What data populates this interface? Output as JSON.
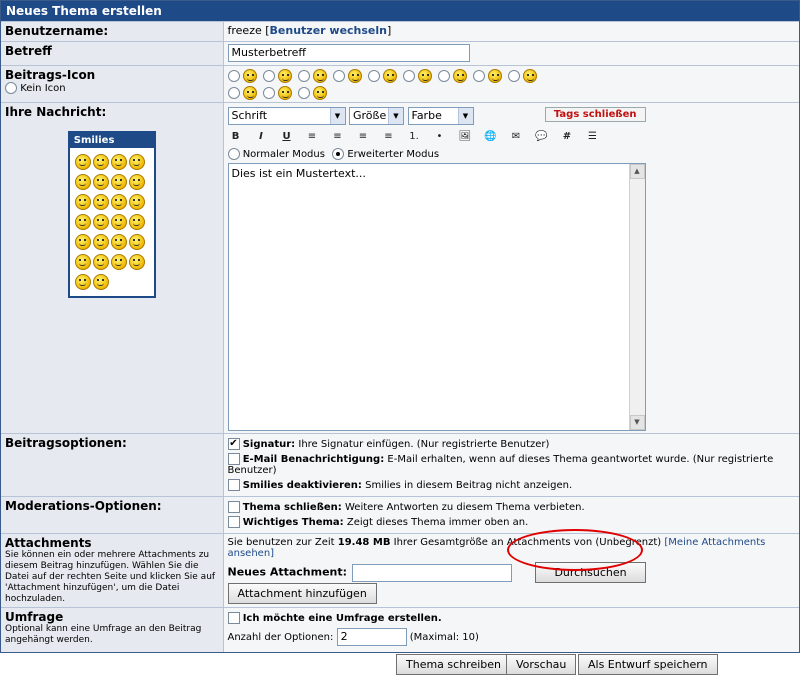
{
  "page_title": "Neues Thema erstellen",
  "username": {
    "label": "Benutzername:",
    "value": "freeze",
    "switch_link": "Benutzer wechseln"
  },
  "subject": {
    "label": "Betreff",
    "value": "Musterbetreff"
  },
  "post_icon": {
    "label": "Beitrags-Icon",
    "no_icon": "Kein Icon"
  },
  "message": {
    "label": "Ihre Nachricht:",
    "font_select": "Schrift",
    "size_select": "Größe",
    "color_select": "Farbe",
    "close_tags": "Tags schließen",
    "toolbar": [
      "B",
      "I",
      "U",
      "≡",
      "≡",
      "≡",
      "≡",
      "1.",
      "•",
      "🖼",
      "🌐",
      "✉",
      "💬",
      "#",
      "☰"
    ],
    "mode_normal": "Normaler Modus",
    "mode_extended": "Erweiterter Modus",
    "text": "Dies ist ein Mustertext..."
  },
  "smilies_header": "Smilies",
  "options": {
    "label": "Beitragsoptionen:",
    "signature_bold": "Signatur:",
    "signature_text": "Ihre Signatur einfügen. (Nur registrierte Benutzer)",
    "email_bold": "E-Mail Benachrichtigung:",
    "email_text": "E-Mail erhalten, wenn auf dieses Thema geantwortet wurde. (Nur registrierte Benutzer)",
    "smilies_bold": "Smilies deaktivieren:",
    "smilies_text": "Smilies in diesem Beitrag nicht anzeigen."
  },
  "moderation": {
    "label": "Moderations-Optionen:",
    "close_bold": "Thema schließen:",
    "close_text": "Weitere Antworten zu diesem Thema verbieten.",
    "sticky_bold": "Wichtiges Thema:",
    "sticky_text": "Zeigt dieses Thema immer oben an."
  },
  "attachments": {
    "label": "Attachments",
    "desc": "Sie können ein oder mehrere Attachments zu diesem Beitrag hinzufügen. Wählen Sie die Datei auf der rechten Seite und klicken Sie auf 'Attachment hinzufügen', um die Datei hochzuladen.",
    "usage_prefix": "Sie benutzen zur Zeit",
    "usage_size": "19.48 MB",
    "usage_suffix": "Ihrer Gesamtgröße an Attachments von (Unbegrenzt)",
    "my_attachments": "[Meine Attachments ansehen]",
    "new_label": "Neues Attachment:",
    "browse": "Durchsuchen",
    "add": "Attachment hinzufügen"
  },
  "poll": {
    "label": "Umfrage",
    "desc": "Optional kann eine Umfrage an den Beitrag angehängt werden.",
    "create": "Ich möchte eine Umfrage erstellen.",
    "count_label": "Anzahl der Optionen:",
    "count_value": "2",
    "max": "(Maximal: 10)"
  },
  "buttons": {
    "submit": "Thema schreiben",
    "preview": "Vorschau",
    "draft": "Als Entwurf speichern"
  }
}
